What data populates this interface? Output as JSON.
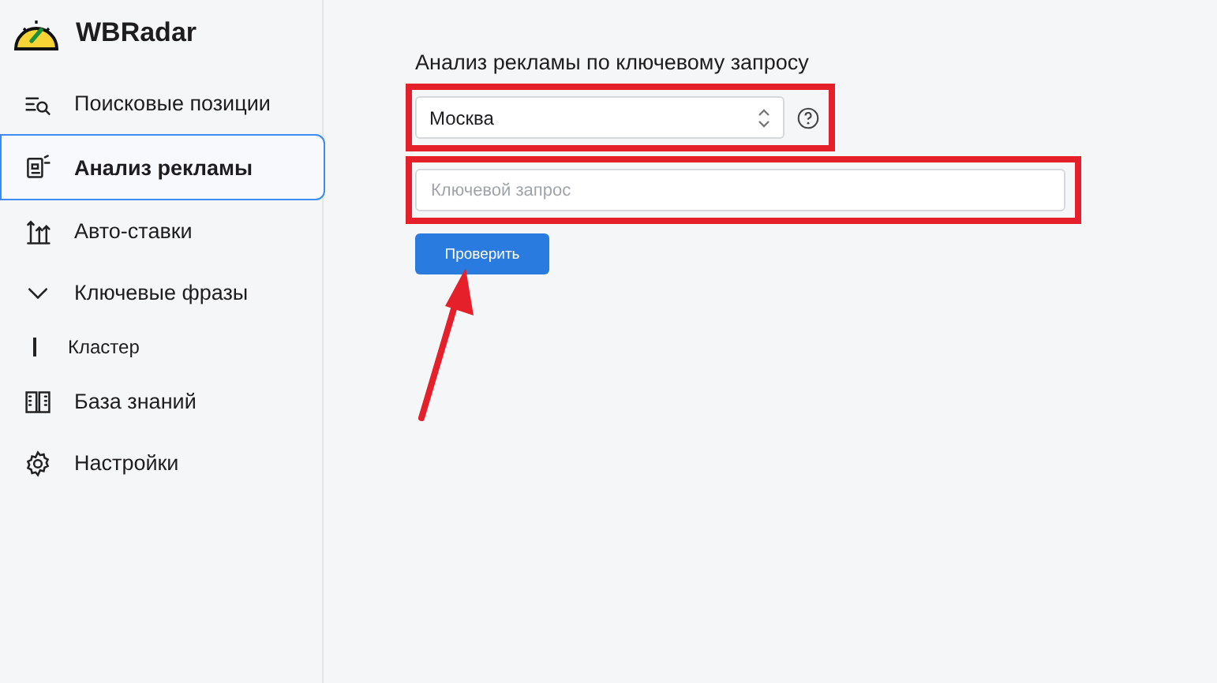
{
  "sidebar": {
    "brand": "WBRadar",
    "items": [
      {
        "kind": "item",
        "label": "Поисковые позиции",
        "selected": false
      },
      {
        "kind": "item",
        "label": "Анализ рекламы",
        "selected": true
      },
      {
        "kind": "item",
        "label": "Авто-ставки",
        "selected": false
      },
      {
        "kind": "group",
        "label": "Ключевые фразы",
        "selected": false,
        "expanded": true,
        "children": [
          {
            "kind": "subitem",
            "label": "Кластер",
            "selected": false
          }
        ]
      },
      {
        "kind": "item",
        "label": "База знаний",
        "selected": false
      },
      {
        "kind": "item",
        "label": "Настройки",
        "selected": false
      }
    ]
  },
  "main": {
    "title": "Анализ рекламы по ключевому запросу",
    "region_select": {
      "value": "Москва",
      "highlighted": true
    },
    "keyword_field": {
      "placeholder": "Ключевой запрос",
      "highlighted": true
    },
    "check_button": {
      "label": "Проверить",
      "pointed_at": true
    }
  }
}
